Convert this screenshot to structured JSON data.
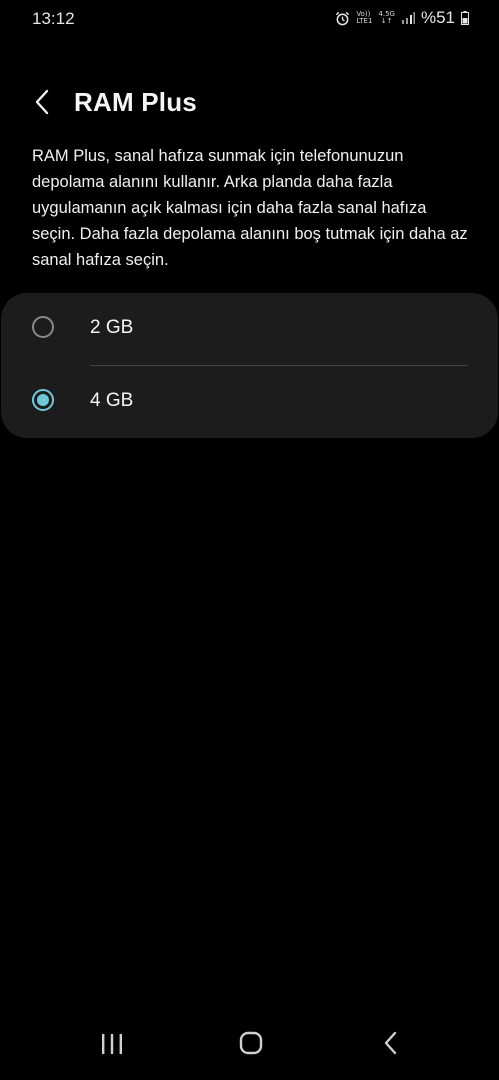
{
  "status_bar": {
    "time": "13:12",
    "volte_top": "Vo))",
    "volte_bottom": "LTE1",
    "network_type": "4.5G",
    "network_arrows": "↓↑",
    "battery": "%51",
    "icons": [
      "alarm-icon",
      "volte-icon",
      "network-4.5g-icon",
      "signal-icon",
      "battery-icon"
    ]
  },
  "header": {
    "title": "RAM Plus",
    "back_icon": "chevron-left-icon"
  },
  "description": "RAM Plus, sanal hafıza sunmak için telefonunuzun depolama alanını kullanır. Arka planda daha fazla uygulamanın açık kalması için daha fazla sanal hafıza seçin. Daha fazla depolama alanını boş tutmak için daha az sanal hafıza seçin.",
  "options": [
    {
      "label": "2 GB",
      "selected": false
    },
    {
      "label": "4 GB",
      "selected": true
    }
  ],
  "colors": {
    "background": "#000000",
    "card": "#1c1c1c",
    "accent": "#6fc9dc",
    "text": "#f2f2f2"
  },
  "nav_bar": {
    "icons": [
      "recents-icon",
      "home-icon",
      "back-icon"
    ]
  }
}
